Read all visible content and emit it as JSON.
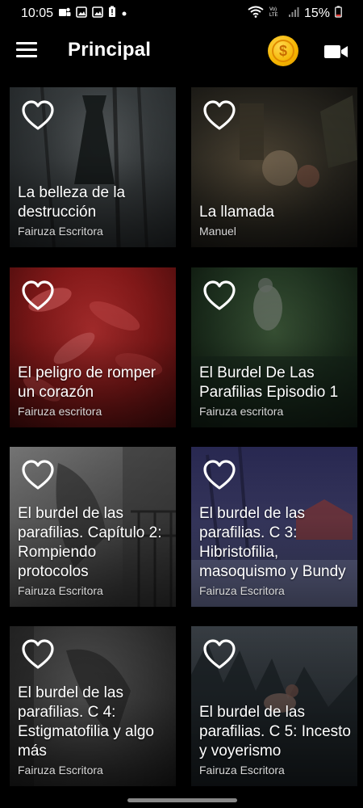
{
  "status": {
    "time": "10:05",
    "battery": "15%",
    "left_icons": [
      "teams-icon",
      "image-icon",
      "image-icon",
      "battery-alert-icon",
      "dot"
    ],
    "right_icons": [
      "wifi-icon",
      "volte-icon",
      "signal-icon",
      "battery-icon"
    ]
  },
  "app_bar": {
    "title": "Principal",
    "coin_symbol": "$"
  },
  "cards": [
    {
      "title": "La belleza de la destrucción",
      "author": "Fairuza Escritora",
      "theme": "#2c3235"
    },
    {
      "title": "La llamada",
      "author": "Manuel",
      "theme": "#2d2a22"
    },
    {
      "title": "El peligro de romper un corazón",
      "author": "Fairuza escritora",
      "theme": "#8a1a1a"
    },
    {
      "title": "El Burdel De Las Parafilias Episodio 1",
      "author": "Fairuza escritora",
      "theme": "#1f3320"
    },
    {
      "title": "El burdel de las parafilias. Capítulo 2: Rompiendo protocolos",
      "author": "Fairuza Escritora",
      "theme": "#5a5a5a"
    },
    {
      "title": "El burdel de las parafilias. C 3: Hibristofilia, masoquismo y Bundy",
      "author": "Fairuza Escritora",
      "theme": "#3a3a66"
    },
    {
      "title": "El burdel de las parafilias. C 4: Estigmatofilia y algo más",
      "author": "Fairuza Escritora",
      "theme": "#3a3a3a"
    },
    {
      "title": "El burdel de las parafilias. C 5: Incesto y voyerismo",
      "author": "Fairuza Escritora",
      "theme": "#2b3136"
    }
  ]
}
